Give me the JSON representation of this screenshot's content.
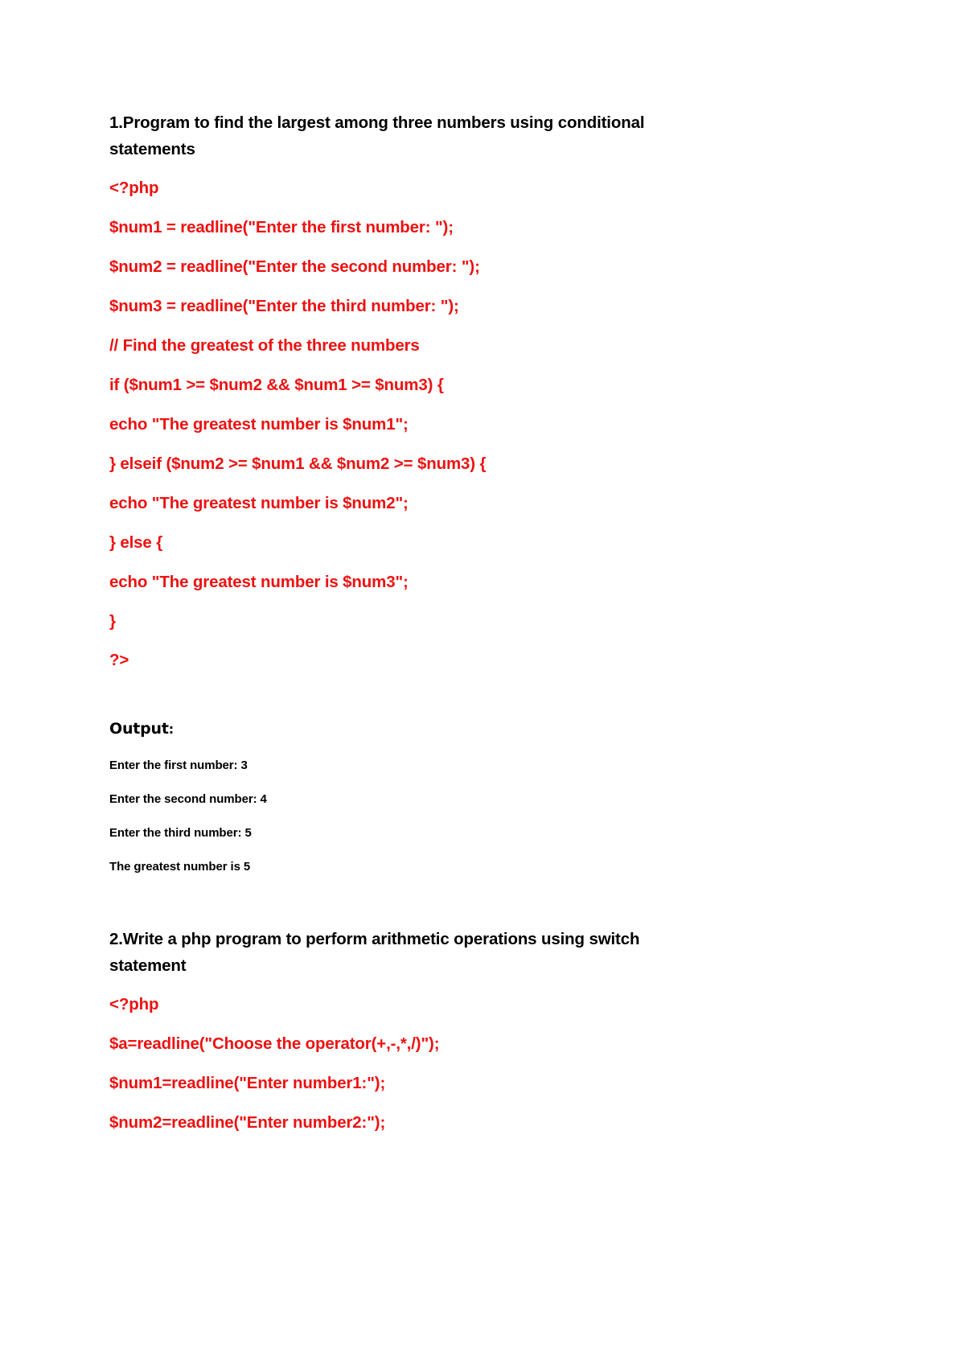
{
  "document": {
    "background_color": "#ffffff",
    "code_color": "#ee1111",
    "text_color": "#000000"
  },
  "sections": [
    {
      "heading": "1.Program to find the largest among three numbers using conditional statements",
      "code": [
        "<?php",
        "$num1 = readline(\"Enter the first number: \");",
        "$num2 = readline(\"Enter the second number: \");",
        "$num3 = readline(\"Enter the third number: \");",
        "// Find the greatest of the three numbers",
        "if ($num1 >= $num2 && $num1 >= $num3) {",
        "echo \"The greatest number is $num1\";",
        "} elseif ($num2 >= $num1 && $num2 >= $num3) {",
        "echo \"The greatest number is $num2\";",
        "} else {",
        "echo \"The greatest number is $num3\";",
        "}",
        "?>"
      ],
      "output_label": "Output",
      "output_label_colon": ":",
      "output": [
        "Enter the first number: 3",
        "Enter the second number: 4",
        "Enter the third number: 5",
        "The greatest number is 5"
      ]
    },
    {
      "heading": "2.Write a php program to perform arithmetic operations using switch statement",
      "code": [
        "<?php",
        "$a=readline(\"Choose the operator(+,-,*,/)\");",
        "$num1=readline(\"Enter number1:\");",
        "$num2=readline(\"Enter number2:\");"
      ]
    }
  ]
}
